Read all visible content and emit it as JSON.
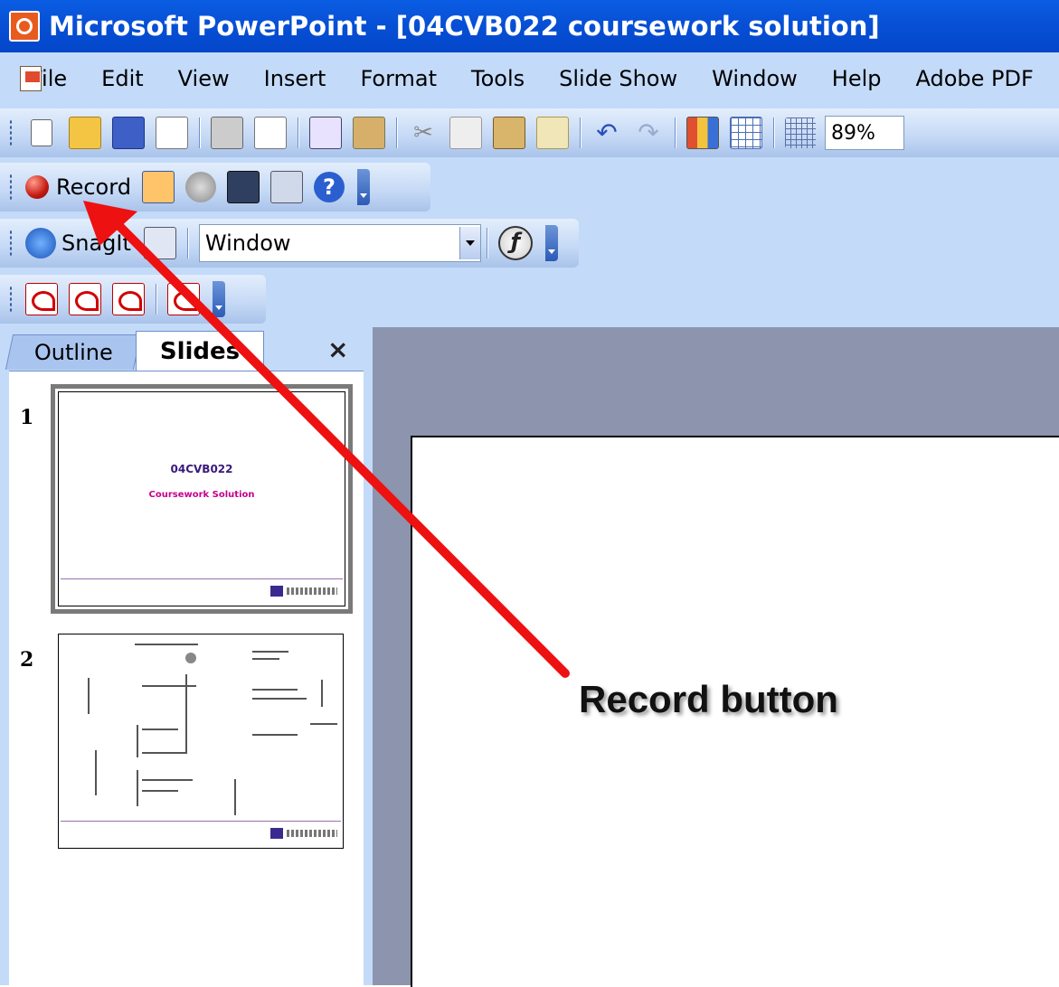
{
  "window": {
    "title": "Microsoft PowerPoint - [04CVB022 coursework solution]"
  },
  "menu": [
    "File",
    "Edit",
    "View",
    "Insert",
    "Format",
    "Tools",
    "Slide Show",
    "Window",
    "Help",
    "Adobe PDF"
  ],
  "standard_toolbar": {
    "zoom": "89%"
  },
  "record_toolbar": {
    "record_label": "Record"
  },
  "snagit_toolbar": {
    "snagit_label": "SnagIt",
    "capture_mode": "Window"
  },
  "pane": {
    "tab_outline": "Outline",
    "tab_slides": "Slides",
    "close": "×"
  },
  "slides": [
    {
      "number": "1",
      "title": "04CVB022",
      "subtitle": "Coursework Solution"
    },
    {
      "number": "2"
    }
  ],
  "annotation": {
    "callout": "Record button",
    "arrow_color": "#ee1111"
  }
}
